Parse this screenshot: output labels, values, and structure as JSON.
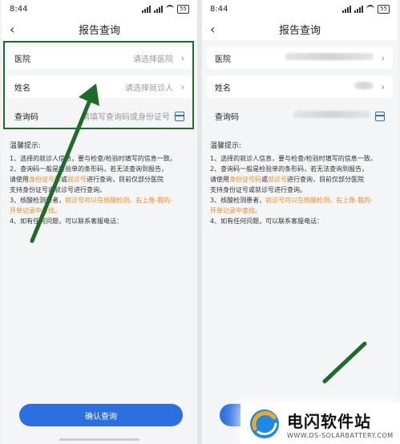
{
  "status": {
    "time": "8:44",
    "battery": "55"
  },
  "nav": {
    "title": "报告查询"
  },
  "form": {
    "hospital_label": "医院",
    "hospital_placeholder": "请选择医院",
    "name_label": "姓名",
    "name_placeholder": "请选择就诊人",
    "query_label": "查询码",
    "query_placeholder": "请填写查询码或身份证号"
  },
  "tips": {
    "title": "温馨提示:",
    "l1": "1、选择的就诊人信息，要与检查/检验时填写的信息一致。",
    "l2a": "2、查询码一般是检验单的条形码，若无法查询到报告，",
    "l2b_pre": "请使用",
    "l2b_o1": "身份证号码",
    "l2b_mid": "或",
    "l2b_o2": "就诊号",
    "l2b_post": "进行查询，目前仅部分医院",
    "l2c": "支持身份证号或就诊号进行查询。",
    "l3_pre": "3、核酸检测患者，",
    "l3_o": "就诊号可以在核酸检测，右上角-我的-",
    "l3_o2": "开单记录中查找。",
    "l4": "4、如有任何问题，可以联系客服电话："
  },
  "button": {
    "confirm": "确认查询"
  },
  "watermark": {
    "main": "电闪软件站",
    "sub": "WWW.DS-SOLARBATTERY.COM"
  },
  "colors": {
    "accent": "#2c6fe0",
    "highlight": "#f08a1c",
    "arrow": "#1f6b2a"
  }
}
